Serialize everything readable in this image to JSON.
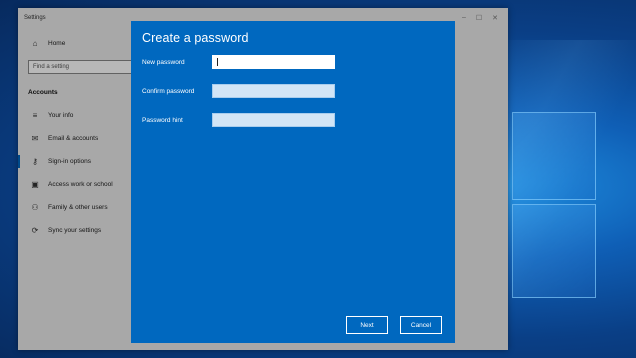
{
  "settings_window": {
    "title": "Settings",
    "controls": {
      "minimize": "–",
      "maximize": "☐",
      "close": "✕"
    },
    "sidebar": {
      "home": "Home",
      "search_placeholder": "Find a setting",
      "section": "Accounts",
      "items": [
        {
          "label": "Your info",
          "icon": "person-card-icon"
        },
        {
          "label": "Email & accounts",
          "icon": "mail-icon"
        },
        {
          "label": "Sign-in options",
          "icon": "key-icon",
          "active": true
        },
        {
          "label": "Access work or school",
          "icon": "briefcase-icon"
        },
        {
          "label": "Family & other users",
          "icon": "people-icon"
        },
        {
          "label": "Sync your settings",
          "icon": "sync-icon"
        }
      ]
    }
  },
  "dialog": {
    "title": "Create a password",
    "fields": [
      {
        "label": "New password",
        "value": ""
      },
      {
        "label": "Confirm password",
        "value": ""
      },
      {
        "label": "Password hint",
        "value": ""
      }
    ],
    "next_label": "Next",
    "cancel_label": "Cancel"
  },
  "colors": {
    "dialog_bg": "#0068bf",
    "accent": "#0067c0"
  }
}
